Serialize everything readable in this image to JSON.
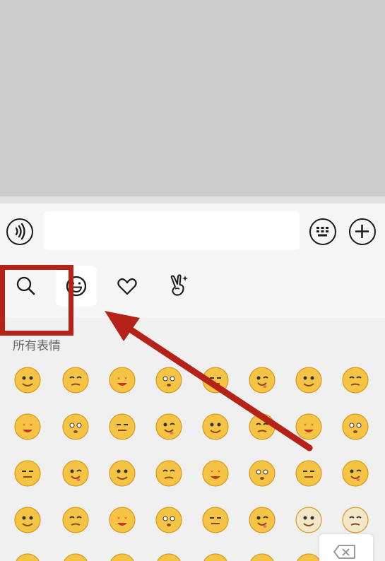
{
  "input_bar": {
    "message_value": "",
    "icons": [
      "voice-icon",
      "keyboard-icon",
      "plus-icon"
    ]
  },
  "tabs": [
    {
      "name": "search",
      "icon": "search-icon",
      "active": false
    },
    {
      "name": "emoji",
      "icon": "smiley-icon",
      "active": true
    },
    {
      "name": "favorites",
      "icon": "heart-icon",
      "active": false
    },
    {
      "name": "gesture",
      "icon": "peace-hand-icon",
      "active": false
    }
  ],
  "panel": {
    "section_title": "所有表情"
  },
  "emoji_rows": 5,
  "emoji_columns": 8,
  "delete_icon": "backspace-icon",
  "colors": {
    "face": "#f5c445",
    "face_outline": "#d59a1e",
    "annotation": "#b52218",
    "panel_bg": "#f0f0f0",
    "bar_bg": "#f6f6f6",
    "chat_bg": "#cccccc"
  }
}
